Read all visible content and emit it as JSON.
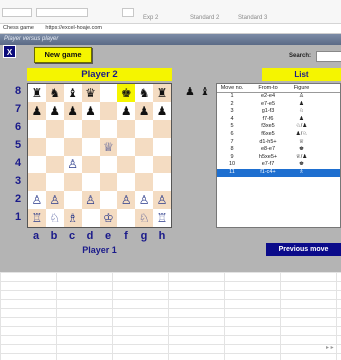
{
  "ribbon": {
    "items": [
      "Exp 2",
      "Standard 2",
      "Standard 3"
    ]
  },
  "address": {
    "tab": "Chess game",
    "url": "https://excel-hoaje.com"
  },
  "window": {
    "title": "Player versus player",
    "close_label": "X"
  },
  "new_game_label": "New game",
  "player2_label": "Player 2",
  "player1_label": "Player 1",
  "search_label": "Search:",
  "list_label": "List",
  "previous_move_label": "Previous move",
  "ranks": [
    "8",
    "7",
    "6",
    "5",
    "4",
    "3",
    "2",
    "1"
  ],
  "files": [
    "a",
    "b",
    "c",
    "d",
    "e",
    "f",
    "g",
    "h"
  ],
  "board": [
    [
      "♜",
      "♞",
      "♝",
      "♛",
      "",
      "♚",
      "♞",
      "♜"
    ],
    [
      "♟",
      "♟",
      "♟",
      "♟",
      "",
      "♟",
      "♟",
      "♟"
    ],
    [
      "",
      "",
      "",
      "",
      "",
      "",
      "",
      ""
    ],
    [
      "",
      "",
      "",
      "",
      "♕",
      "",
      "",
      ""
    ],
    [
      "",
      "",
      "♙",
      "",
      "",
      "",
      "",
      ""
    ],
    [
      "",
      "",
      "",
      "",
      "",
      "",
      "",
      ""
    ],
    [
      "♙",
      "♙",
      "",
      "♙",
      "",
      "♙",
      "♙",
      "♙"
    ],
    [
      "♖",
      "♘",
      "♗",
      "",
      "♔",
      "",
      "♘",
      "♖"
    ]
  ],
  "captured": [
    "♟",
    "♝"
  ],
  "moves": {
    "headers": [
      "Move no.",
      "From-to",
      "Figure"
    ],
    "rows": [
      [
        "1",
        "e2-e4",
        "♙"
      ],
      [
        "2",
        "e7-e5",
        "♟"
      ],
      [
        "3",
        "g1-f3",
        "♘"
      ],
      [
        "4",
        "f7-f6",
        "♟"
      ],
      [
        "5",
        "f3xe5",
        "♘/♟"
      ],
      [
        "6",
        "f6xe5",
        "♟/♘"
      ],
      [
        "7",
        "d1-h5+",
        "♕"
      ],
      [
        "8",
        "e8-e7",
        "♚"
      ],
      [
        "9",
        "h5xe5+",
        "♕/♟"
      ],
      [
        "10",
        "e7-f7",
        "♚"
      ],
      [
        "11",
        "f1-c4+",
        "♗"
      ]
    ],
    "selected_index": 10
  },
  "colors": {
    "window_bg": "#b4b4b4",
    "yellow": "#f5f500",
    "navy": "#1a1a8a",
    "light_square": "#ffffff",
    "dark_square": "#f4dcc2",
    "selection": "#1e6fd0"
  }
}
